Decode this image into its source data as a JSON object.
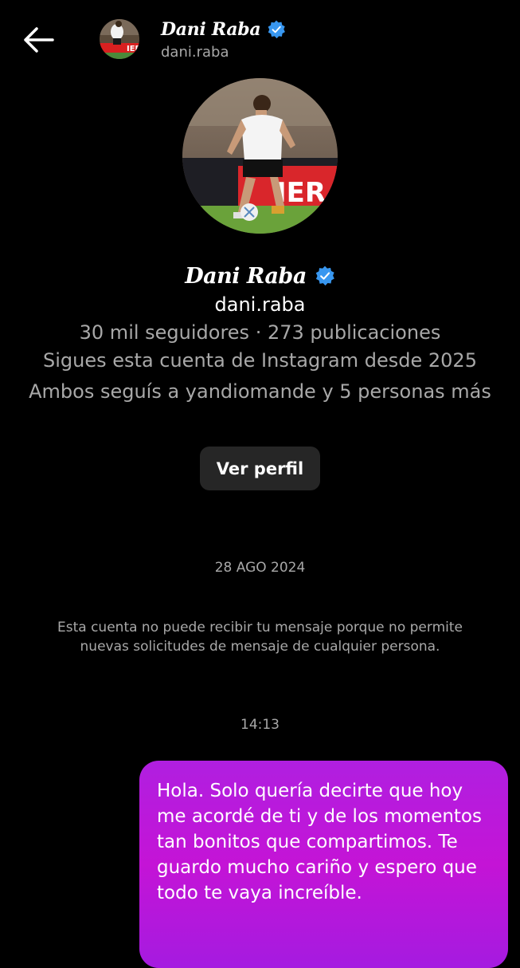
{
  "header": {
    "back_icon": "arrow-left-icon",
    "name": "Dani Raba",
    "username": "dani.raba",
    "verified_color": "#3897f0"
  },
  "profile": {
    "name": "Dani Raba",
    "username": "dani.raba",
    "stats": "30 mil seguidores · 273 publicaciones",
    "follow_since": "Sigues esta cuenta de Instagram desde 2025",
    "mutual": "Ambos seguís a yandiomande y 5 personas más",
    "view_profile_label": "Ver perfil"
  },
  "conversation": {
    "date_separator": "28 AGO 2024",
    "system_message": "Esta cuenta no puede recibir tu mensaje porque no permite nuevas solicitudes de mensaje de cualquier persona.",
    "time_separator": "14:13",
    "messages": [
      {
        "from": "me",
        "text": "Hola. Solo quería decirte que hoy me acordé de ti y de los momentos tan bonitos que compartimos. Te guardo mucho cariño y espero que todo te vaya increíble."
      }
    ]
  },
  "colors": {
    "background": "#000000",
    "muted_text": "#a8a8a8",
    "button_bg": "#262626",
    "bubble_gradient_start": "#b01fe0",
    "bubble_gradient_end": "#a51be0"
  }
}
